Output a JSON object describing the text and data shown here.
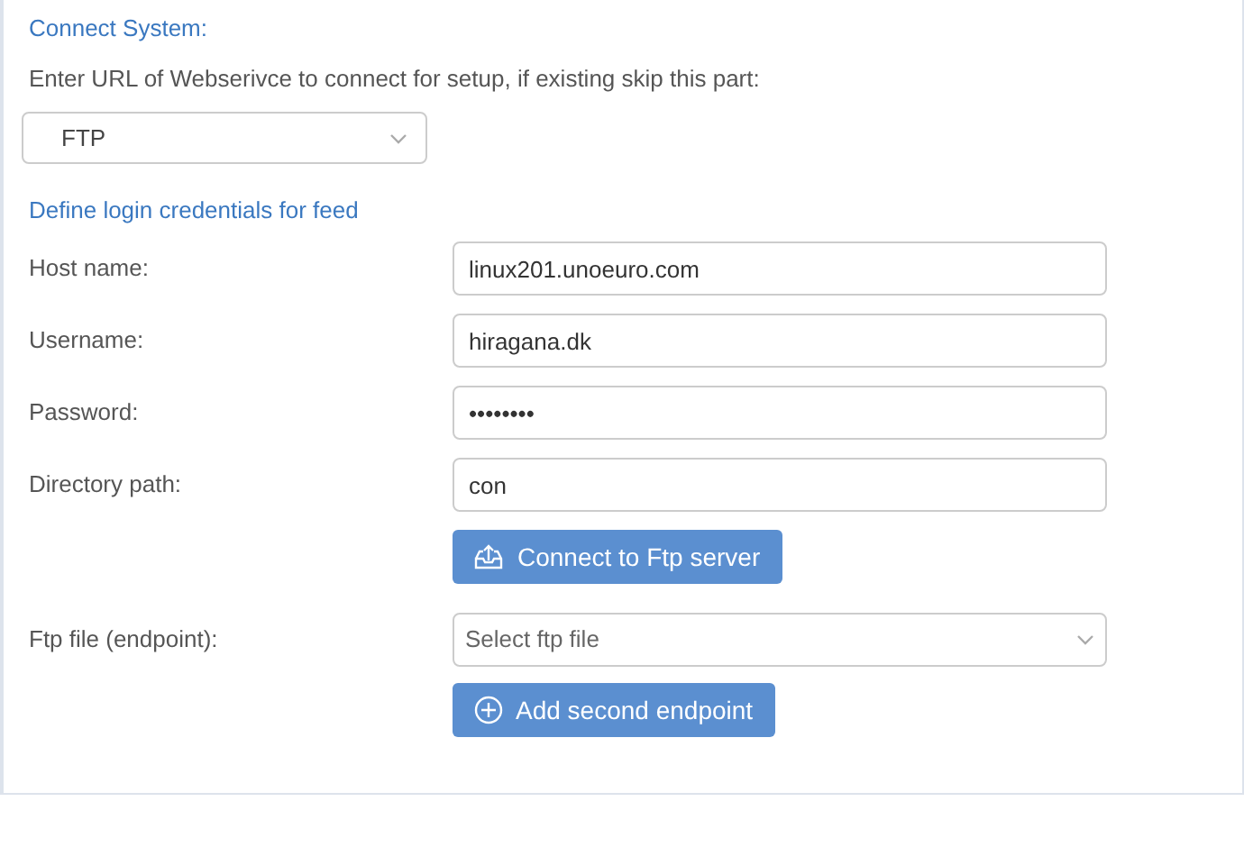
{
  "heading": "Connect System:",
  "description": "Enter URL of Webserivce to connect for setup, if existing skip this part:",
  "system_select": {
    "value": "FTP"
  },
  "credentials_heading": "Define login credentials for feed",
  "fields": [
    {
      "label": "Host name:",
      "value": "linux201.unoeuro.com"
    },
    {
      "label": "Username:",
      "value": "hiragana.dk"
    },
    {
      "label": "Password:",
      "value": "••••••••"
    },
    {
      "label": "Directory path:",
      "value": "con"
    }
  ],
  "connect_button": "Connect to Ftp server",
  "endpoint": {
    "label": "Ftp file (endpoint):",
    "placeholder": "Select ftp file"
  },
  "add_button": "Add second endpoint"
}
